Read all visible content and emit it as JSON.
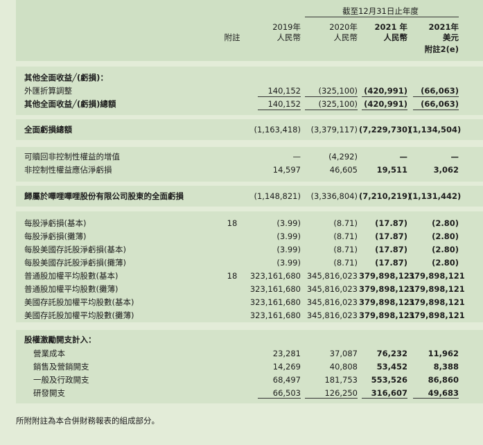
{
  "header": {
    "period": "截至12月31日止年度",
    "note_label": "附註",
    "col1_year": "2019年",
    "col1_cur": "人民幣",
    "col2_year": "2020年",
    "col2_cur": "人民幣",
    "col3_year": "2021 年",
    "col3_cur": "人民幣",
    "col4_year": "2021年",
    "col4_cur": "美元",
    "col4_note": "附註2(e)"
  },
  "oci": {
    "heading": "其他全面收益╱(虧損)：",
    "fx_label": "外匯折算調整",
    "fx": [
      "140,152",
      "(325,100)",
      "(420,991)",
      "(66,063)"
    ],
    "total_label": "其他全面收益╱(虧損)總額",
    "total": [
      "140,152",
      "(325,100)",
      "(420,991)",
      "(66,063)"
    ]
  },
  "comprehensive_loss": {
    "label": "全面虧損總額",
    "values": [
      "(1,163,418)",
      "(3,379,117)",
      "(7,229,730)",
      "(1,134,504)"
    ]
  },
  "nci": {
    "accretion_label": "可贖回非控制性權益的增值",
    "accretion": [
      "—",
      "(4,292)",
      "—",
      "—"
    ],
    "share_label": "非控制性權益應佔淨虧損",
    "share": [
      "14,597",
      "46,605",
      "19,511",
      "3,062"
    ]
  },
  "attributable": {
    "label": "歸屬於嗶哩嗶哩股份有限公司股東的全面虧損",
    "values": [
      "(1,148,821)",
      "(3,336,804)",
      "(7,210,219)",
      "(1,131,442)"
    ]
  },
  "per_share": [
    {
      "label": "每股淨虧損(基本)",
      "note": "18",
      "values": [
        "(3.99)",
        "(8.71)",
        "(17.87)",
        "(2.80)"
      ]
    },
    {
      "label": "每股淨虧損(攤薄)",
      "note": "",
      "values": [
        "(3.99)",
        "(8.71)",
        "(17.87)",
        "(2.80)"
      ]
    },
    {
      "label": "每股美國存託股淨虧損(基本)",
      "note": "",
      "values": [
        "(3.99)",
        "(8.71)",
        "(17.87)",
        "(2.80)"
      ]
    },
    {
      "label": "每股美國存託股淨虧損(攤薄)",
      "note": "",
      "values": [
        "(3.99)",
        "(8.71)",
        "(17.87)",
        "(2.80)"
      ]
    },
    {
      "label": "普通股加權平均股數(基本)",
      "note": "18",
      "values": [
        "323,161,680",
        "345,816,023",
        "379,898,121",
        "379,898,121"
      ]
    },
    {
      "label": "普通股加權平均股數(攤薄)",
      "note": "",
      "values": [
        "323,161,680",
        "345,816,023",
        "379,898,121",
        "379,898,121"
      ]
    },
    {
      "label": "美國存託股加權平均股數(基本)",
      "note": "",
      "values": [
        "323,161,680",
        "345,816,023",
        "379,898,121",
        "379,898,121"
      ]
    },
    {
      "label": "美國存託股加權平均股數(攤薄)",
      "note": "",
      "values": [
        "323,161,680",
        "345,816,023",
        "379,898,121",
        "379,898,121"
      ]
    }
  ],
  "sbc": {
    "heading": "股權激勵開支計入：",
    "rows": [
      {
        "label": "營業成本",
        "values": [
          "23,281",
          "37,087",
          "76,232",
          "11,962"
        ]
      },
      {
        "label": "銷售及營銷開支",
        "values": [
          "14,269",
          "40,808",
          "53,452",
          "8,388"
        ]
      },
      {
        "label": "一般及行政開支",
        "values": [
          "68,497",
          "181,753",
          "553,526",
          "86,860"
        ]
      },
      {
        "label": "研發開支",
        "values": [
          "66,503",
          "126,250",
          "316,607",
          "49,683"
        ]
      }
    ]
  },
  "footer": {
    "note": "所附附註為本合併財務報表的組成部分。"
  }
}
